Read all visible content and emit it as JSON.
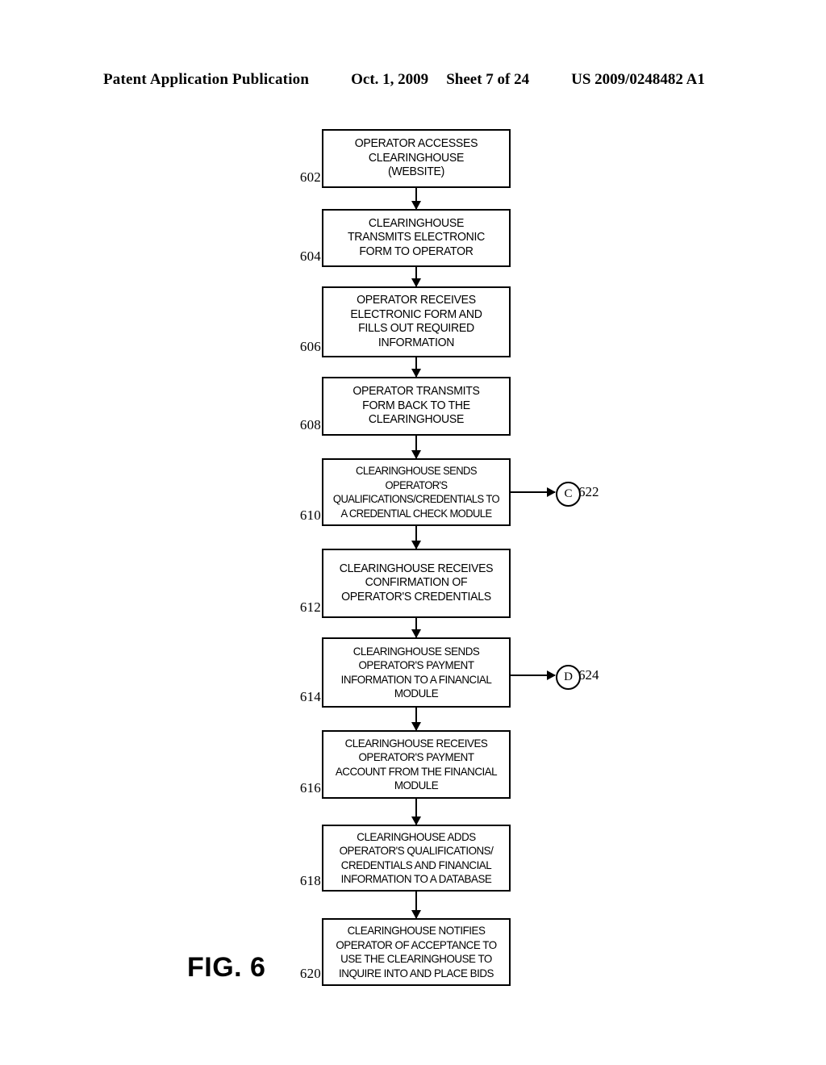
{
  "header": {
    "publication": "Patent Application Publication",
    "date": "Oct. 1, 2009",
    "sheet": "Sheet 7 of 24",
    "doc_number": "US 2009/0248482 A1"
  },
  "figure": {
    "caption": "FIG. 6",
    "steps": [
      {
        "ref": "602",
        "text": "OPERATOR ACCESSES\nCLEARINGHOUSE\n(WEBSITE)"
      },
      {
        "ref": "604",
        "text": "CLEARINGHOUSE\nTRANSMITS ELECTRONIC\nFORM TO OPERATOR"
      },
      {
        "ref": "606",
        "text": "OPERATOR RECEIVES\nELECTRONIC FORM AND\nFILLS OUT REQUIRED\nINFORMATION"
      },
      {
        "ref": "608",
        "text": "OPERATOR TRANSMITS\nFORM BACK TO THE\nCLEARINGHOUSE"
      },
      {
        "ref": "610",
        "text": "CLEARINGHOUSE SENDS\nOPERATOR'S\nQUALIFICATIONS/CREDENTIALS TO\nA CREDENTIAL CHECK MODULE"
      },
      {
        "ref": "612",
        "text": "CLEARINGHOUSE RECEIVES\nCONFIRMATION OF\nOPERATOR'S CREDENTIALS"
      },
      {
        "ref": "614",
        "text": "CLEARINGHOUSE SENDS\nOPERATOR'S PAYMENT\nINFORMATION TO A FINANCIAL\nMODULE"
      },
      {
        "ref": "616",
        "text": "CLEARINGHOUSE RECEIVES\nOPERATOR'S PAYMENT\nACCOUNT FROM THE FINANCIAL\nMODULE"
      },
      {
        "ref": "618",
        "text": "CLEARINGHOUSE ADDS\nOPERATOR'S QUALIFICATIONS/\nCREDENTIALS AND FINANCIAL\nINFORMATION TO A DATABASE"
      },
      {
        "ref": "620",
        "text": "CLEARINGHOUSE NOTIFIES\nOPERATOR OF ACCEPTANCE TO\nUSE THE CLEARINGHOUSE TO\nINQUIRE INTO AND PLACE BIDS"
      }
    ],
    "connectors": [
      {
        "symbol": "C",
        "ref": "622",
        "from_step": "610"
      },
      {
        "symbol": "D",
        "ref": "624",
        "from_step": "614"
      }
    ]
  }
}
